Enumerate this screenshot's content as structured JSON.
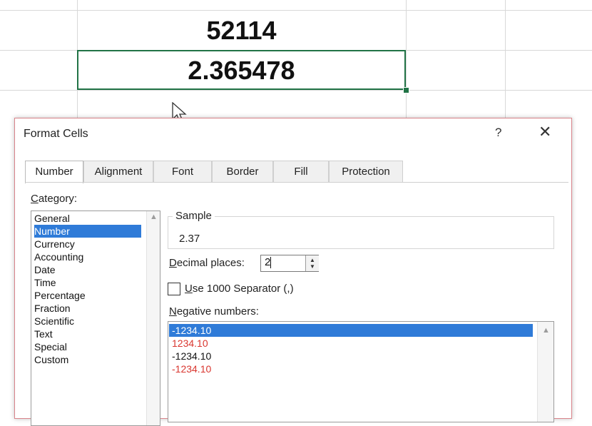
{
  "sheet": {
    "cell_top_value": "52114",
    "cell_selected_value": "2.365478"
  },
  "dialog": {
    "title": "Format Cells",
    "help_label": "?",
    "close_label": "✕",
    "tabs": [
      {
        "label": "Number",
        "active": true
      },
      {
        "label": "Alignment"
      },
      {
        "label": "Font"
      },
      {
        "label": "Border"
      },
      {
        "label": "Fill"
      },
      {
        "label": "Protection"
      }
    ],
    "category": {
      "label_first": "C",
      "label_rest": "ategory:",
      "items": [
        "General",
        "Number",
        "Currency",
        "Accounting",
        "Date",
        "Time",
        "Percentage",
        "Fraction",
        "Scientific",
        "Text",
        "Special",
        "Custom"
      ],
      "selected": "Number"
    },
    "sample": {
      "label": "Sample",
      "value": "2.37"
    },
    "decimal_places": {
      "label_first": "D",
      "label_rest": "ecimal places:",
      "value": "2"
    },
    "separator": {
      "label_first": "U",
      "label_rest": "se 1000 Separator (,)",
      "checked": false
    },
    "negative_numbers": {
      "label_first": "N",
      "label_rest": "egative numbers:",
      "items": [
        {
          "text": "-1234.10",
          "color": "#ffffff",
          "selected": true
        },
        {
          "text": "1234.10",
          "color": "#d9362f"
        },
        {
          "text": "-1234.10",
          "color": "#111111"
        },
        {
          "text": "-1234.10",
          "color": "#d9362f"
        }
      ]
    }
  },
  "colors": {
    "selection_blue": "#2f7bd8",
    "excel_green": "#217346",
    "negative_red": "#d9362f"
  }
}
